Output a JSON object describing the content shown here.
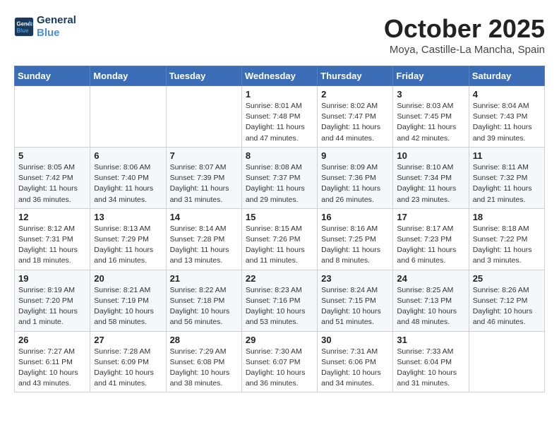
{
  "logo": {
    "line1": "General",
    "line2": "Blue"
  },
  "title": "October 2025",
  "subtitle": "Moya, Castille-La Mancha, Spain",
  "weekdays": [
    "Sunday",
    "Monday",
    "Tuesday",
    "Wednesday",
    "Thursday",
    "Friday",
    "Saturday"
  ],
  "weeks": [
    [
      {
        "day": "",
        "info": ""
      },
      {
        "day": "",
        "info": ""
      },
      {
        "day": "",
        "info": ""
      },
      {
        "day": "1",
        "info": "Sunrise: 8:01 AM\nSunset: 7:48 PM\nDaylight: 11 hours\nand 47 minutes."
      },
      {
        "day": "2",
        "info": "Sunrise: 8:02 AM\nSunset: 7:47 PM\nDaylight: 11 hours\nand 44 minutes."
      },
      {
        "day": "3",
        "info": "Sunrise: 8:03 AM\nSunset: 7:45 PM\nDaylight: 11 hours\nand 42 minutes."
      },
      {
        "day": "4",
        "info": "Sunrise: 8:04 AM\nSunset: 7:43 PM\nDaylight: 11 hours\nand 39 minutes."
      }
    ],
    [
      {
        "day": "5",
        "info": "Sunrise: 8:05 AM\nSunset: 7:42 PM\nDaylight: 11 hours\nand 36 minutes."
      },
      {
        "day": "6",
        "info": "Sunrise: 8:06 AM\nSunset: 7:40 PM\nDaylight: 11 hours\nand 34 minutes."
      },
      {
        "day": "7",
        "info": "Sunrise: 8:07 AM\nSunset: 7:39 PM\nDaylight: 11 hours\nand 31 minutes."
      },
      {
        "day": "8",
        "info": "Sunrise: 8:08 AM\nSunset: 7:37 PM\nDaylight: 11 hours\nand 29 minutes."
      },
      {
        "day": "9",
        "info": "Sunrise: 8:09 AM\nSunset: 7:36 PM\nDaylight: 11 hours\nand 26 minutes."
      },
      {
        "day": "10",
        "info": "Sunrise: 8:10 AM\nSunset: 7:34 PM\nDaylight: 11 hours\nand 23 minutes."
      },
      {
        "day": "11",
        "info": "Sunrise: 8:11 AM\nSunset: 7:32 PM\nDaylight: 11 hours\nand 21 minutes."
      }
    ],
    [
      {
        "day": "12",
        "info": "Sunrise: 8:12 AM\nSunset: 7:31 PM\nDaylight: 11 hours\nand 18 minutes."
      },
      {
        "day": "13",
        "info": "Sunrise: 8:13 AM\nSunset: 7:29 PM\nDaylight: 11 hours\nand 16 minutes."
      },
      {
        "day": "14",
        "info": "Sunrise: 8:14 AM\nSunset: 7:28 PM\nDaylight: 11 hours\nand 13 minutes."
      },
      {
        "day": "15",
        "info": "Sunrise: 8:15 AM\nSunset: 7:26 PM\nDaylight: 11 hours\nand 11 minutes."
      },
      {
        "day": "16",
        "info": "Sunrise: 8:16 AM\nSunset: 7:25 PM\nDaylight: 11 hours\nand 8 minutes."
      },
      {
        "day": "17",
        "info": "Sunrise: 8:17 AM\nSunset: 7:23 PM\nDaylight: 11 hours\nand 6 minutes."
      },
      {
        "day": "18",
        "info": "Sunrise: 8:18 AM\nSunset: 7:22 PM\nDaylight: 11 hours\nand 3 minutes."
      }
    ],
    [
      {
        "day": "19",
        "info": "Sunrise: 8:19 AM\nSunset: 7:20 PM\nDaylight: 11 hours\nand 1 minute."
      },
      {
        "day": "20",
        "info": "Sunrise: 8:21 AM\nSunset: 7:19 PM\nDaylight: 10 hours\nand 58 minutes."
      },
      {
        "day": "21",
        "info": "Sunrise: 8:22 AM\nSunset: 7:18 PM\nDaylight: 10 hours\nand 56 minutes."
      },
      {
        "day": "22",
        "info": "Sunrise: 8:23 AM\nSunset: 7:16 PM\nDaylight: 10 hours\nand 53 minutes."
      },
      {
        "day": "23",
        "info": "Sunrise: 8:24 AM\nSunset: 7:15 PM\nDaylight: 10 hours\nand 51 minutes."
      },
      {
        "day": "24",
        "info": "Sunrise: 8:25 AM\nSunset: 7:13 PM\nDaylight: 10 hours\nand 48 minutes."
      },
      {
        "day": "25",
        "info": "Sunrise: 8:26 AM\nSunset: 7:12 PM\nDaylight: 10 hours\nand 46 minutes."
      }
    ],
    [
      {
        "day": "26",
        "info": "Sunrise: 7:27 AM\nSunset: 6:11 PM\nDaylight: 10 hours\nand 43 minutes."
      },
      {
        "day": "27",
        "info": "Sunrise: 7:28 AM\nSunset: 6:09 PM\nDaylight: 10 hours\nand 41 minutes."
      },
      {
        "day": "28",
        "info": "Sunrise: 7:29 AM\nSunset: 6:08 PM\nDaylight: 10 hours\nand 38 minutes."
      },
      {
        "day": "29",
        "info": "Sunrise: 7:30 AM\nSunset: 6:07 PM\nDaylight: 10 hours\nand 36 minutes."
      },
      {
        "day": "30",
        "info": "Sunrise: 7:31 AM\nSunset: 6:06 PM\nDaylight: 10 hours\nand 34 minutes."
      },
      {
        "day": "31",
        "info": "Sunrise: 7:33 AM\nSunset: 6:04 PM\nDaylight: 10 hours\nand 31 minutes."
      },
      {
        "day": "",
        "info": ""
      }
    ]
  ]
}
